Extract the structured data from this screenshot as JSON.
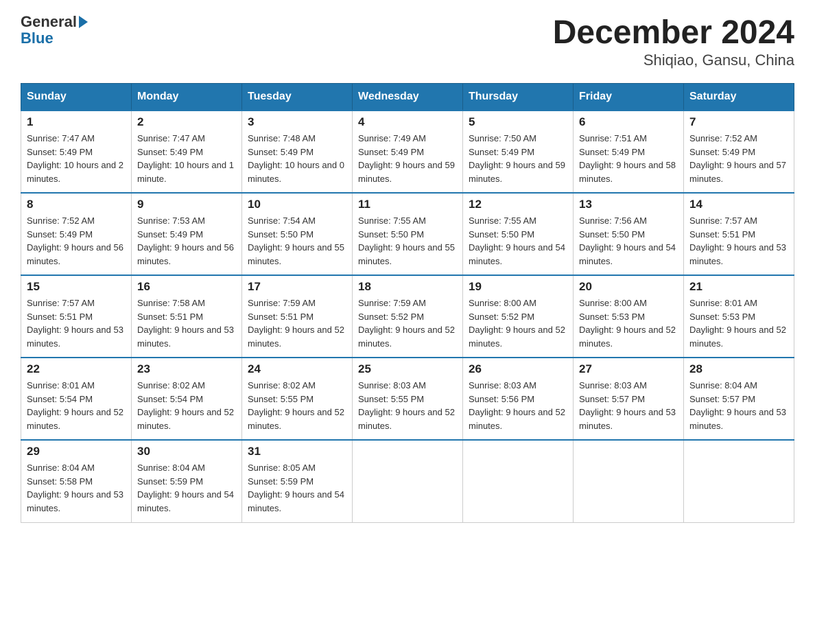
{
  "logo": {
    "text_general": "General",
    "text_blue": "Blue",
    "arrow": "▶"
  },
  "title": "December 2024",
  "subtitle": "Shiqiao, Gansu, China",
  "days_of_week": [
    "Sunday",
    "Monday",
    "Tuesday",
    "Wednesday",
    "Thursday",
    "Friday",
    "Saturday"
  ],
  "weeks": [
    [
      {
        "day": "1",
        "sunrise": "7:47 AM",
        "sunset": "5:49 PM",
        "daylight": "10 hours and 2 minutes."
      },
      {
        "day": "2",
        "sunrise": "7:47 AM",
        "sunset": "5:49 PM",
        "daylight": "10 hours and 1 minute."
      },
      {
        "day": "3",
        "sunrise": "7:48 AM",
        "sunset": "5:49 PM",
        "daylight": "10 hours and 0 minutes."
      },
      {
        "day": "4",
        "sunrise": "7:49 AM",
        "sunset": "5:49 PM",
        "daylight": "9 hours and 59 minutes."
      },
      {
        "day": "5",
        "sunrise": "7:50 AM",
        "sunset": "5:49 PM",
        "daylight": "9 hours and 59 minutes."
      },
      {
        "day": "6",
        "sunrise": "7:51 AM",
        "sunset": "5:49 PM",
        "daylight": "9 hours and 58 minutes."
      },
      {
        "day": "7",
        "sunrise": "7:52 AM",
        "sunset": "5:49 PM",
        "daylight": "9 hours and 57 minutes."
      }
    ],
    [
      {
        "day": "8",
        "sunrise": "7:52 AM",
        "sunset": "5:49 PM",
        "daylight": "9 hours and 56 minutes."
      },
      {
        "day": "9",
        "sunrise": "7:53 AM",
        "sunset": "5:49 PM",
        "daylight": "9 hours and 56 minutes."
      },
      {
        "day": "10",
        "sunrise": "7:54 AM",
        "sunset": "5:50 PM",
        "daylight": "9 hours and 55 minutes."
      },
      {
        "day": "11",
        "sunrise": "7:55 AM",
        "sunset": "5:50 PM",
        "daylight": "9 hours and 55 minutes."
      },
      {
        "day": "12",
        "sunrise": "7:55 AM",
        "sunset": "5:50 PM",
        "daylight": "9 hours and 54 minutes."
      },
      {
        "day": "13",
        "sunrise": "7:56 AM",
        "sunset": "5:50 PM",
        "daylight": "9 hours and 54 minutes."
      },
      {
        "day": "14",
        "sunrise": "7:57 AM",
        "sunset": "5:51 PM",
        "daylight": "9 hours and 53 minutes."
      }
    ],
    [
      {
        "day": "15",
        "sunrise": "7:57 AM",
        "sunset": "5:51 PM",
        "daylight": "9 hours and 53 minutes."
      },
      {
        "day": "16",
        "sunrise": "7:58 AM",
        "sunset": "5:51 PM",
        "daylight": "9 hours and 53 minutes."
      },
      {
        "day": "17",
        "sunrise": "7:59 AM",
        "sunset": "5:51 PM",
        "daylight": "9 hours and 52 minutes."
      },
      {
        "day": "18",
        "sunrise": "7:59 AM",
        "sunset": "5:52 PM",
        "daylight": "9 hours and 52 minutes."
      },
      {
        "day": "19",
        "sunrise": "8:00 AM",
        "sunset": "5:52 PM",
        "daylight": "9 hours and 52 minutes."
      },
      {
        "day": "20",
        "sunrise": "8:00 AM",
        "sunset": "5:53 PM",
        "daylight": "9 hours and 52 minutes."
      },
      {
        "day": "21",
        "sunrise": "8:01 AM",
        "sunset": "5:53 PM",
        "daylight": "9 hours and 52 minutes."
      }
    ],
    [
      {
        "day": "22",
        "sunrise": "8:01 AM",
        "sunset": "5:54 PM",
        "daylight": "9 hours and 52 minutes."
      },
      {
        "day": "23",
        "sunrise": "8:02 AM",
        "sunset": "5:54 PM",
        "daylight": "9 hours and 52 minutes."
      },
      {
        "day": "24",
        "sunrise": "8:02 AM",
        "sunset": "5:55 PM",
        "daylight": "9 hours and 52 minutes."
      },
      {
        "day": "25",
        "sunrise": "8:03 AM",
        "sunset": "5:55 PM",
        "daylight": "9 hours and 52 minutes."
      },
      {
        "day": "26",
        "sunrise": "8:03 AM",
        "sunset": "5:56 PM",
        "daylight": "9 hours and 52 minutes."
      },
      {
        "day": "27",
        "sunrise": "8:03 AM",
        "sunset": "5:57 PM",
        "daylight": "9 hours and 53 minutes."
      },
      {
        "day": "28",
        "sunrise": "8:04 AM",
        "sunset": "5:57 PM",
        "daylight": "9 hours and 53 minutes."
      }
    ],
    [
      {
        "day": "29",
        "sunrise": "8:04 AM",
        "sunset": "5:58 PM",
        "daylight": "9 hours and 53 minutes."
      },
      {
        "day": "30",
        "sunrise": "8:04 AM",
        "sunset": "5:59 PM",
        "daylight": "9 hours and 54 minutes."
      },
      {
        "day": "31",
        "sunrise": "8:05 AM",
        "sunset": "5:59 PM",
        "daylight": "9 hours and 54 minutes."
      },
      null,
      null,
      null,
      null
    ]
  ]
}
